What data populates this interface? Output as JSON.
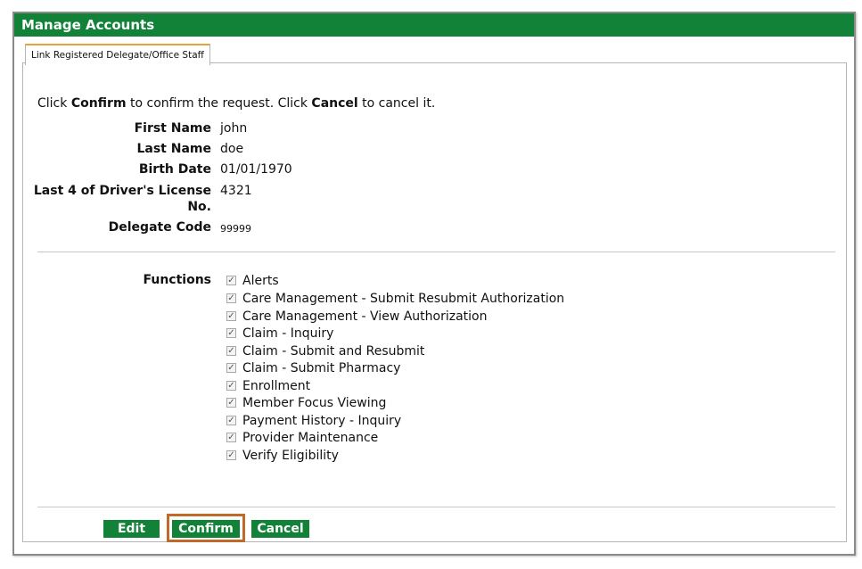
{
  "window": {
    "title": "Manage Accounts"
  },
  "tab": {
    "label": "Link Registered Delegate/Office Staff"
  },
  "instructions": {
    "part1": "Click ",
    "confirm_word": "Confirm",
    "part2": " to confirm the request. Click ",
    "cancel_word": "Cancel",
    "part3": " to cancel it."
  },
  "fields": [
    {
      "label": "First Name",
      "value": "john"
    },
    {
      "label": "Last Name",
      "value": "doe"
    },
    {
      "label": "Birth Date",
      "value": "01/01/1970"
    },
    {
      "label": "Last 4 of Driver's License No.",
      "value": "4321"
    },
    {
      "label": "Delegate Code",
      "value": "99999"
    }
  ],
  "functions": {
    "label": "Functions",
    "items": [
      {
        "label": "Alerts",
        "checked": true
      },
      {
        "label": "Care Management - Submit Resubmit Authorization",
        "checked": true
      },
      {
        "label": "Care Management - View Authorization",
        "checked": true
      },
      {
        "label": "Claim - Inquiry",
        "checked": true
      },
      {
        "label": "Claim - Submit and Resubmit",
        "checked": true
      },
      {
        "label": "Claim - Submit Pharmacy",
        "checked": true
      },
      {
        "label": "Enrollment",
        "checked": true
      },
      {
        "label": "Member Focus Viewing",
        "checked": true
      },
      {
        "label": "Payment History - Inquiry",
        "checked": true
      },
      {
        "label": "Provider Maintenance",
        "checked": true
      },
      {
        "label": "Verify Eligibility",
        "checked": true
      }
    ]
  },
  "buttons": {
    "edit": "Edit",
    "confirm": "Confirm",
    "cancel": "Cancel"
  },
  "colors": {
    "header_green": "#118237",
    "highlight_border": "#c06a2a",
    "tab_accent": "#e6a23c"
  }
}
